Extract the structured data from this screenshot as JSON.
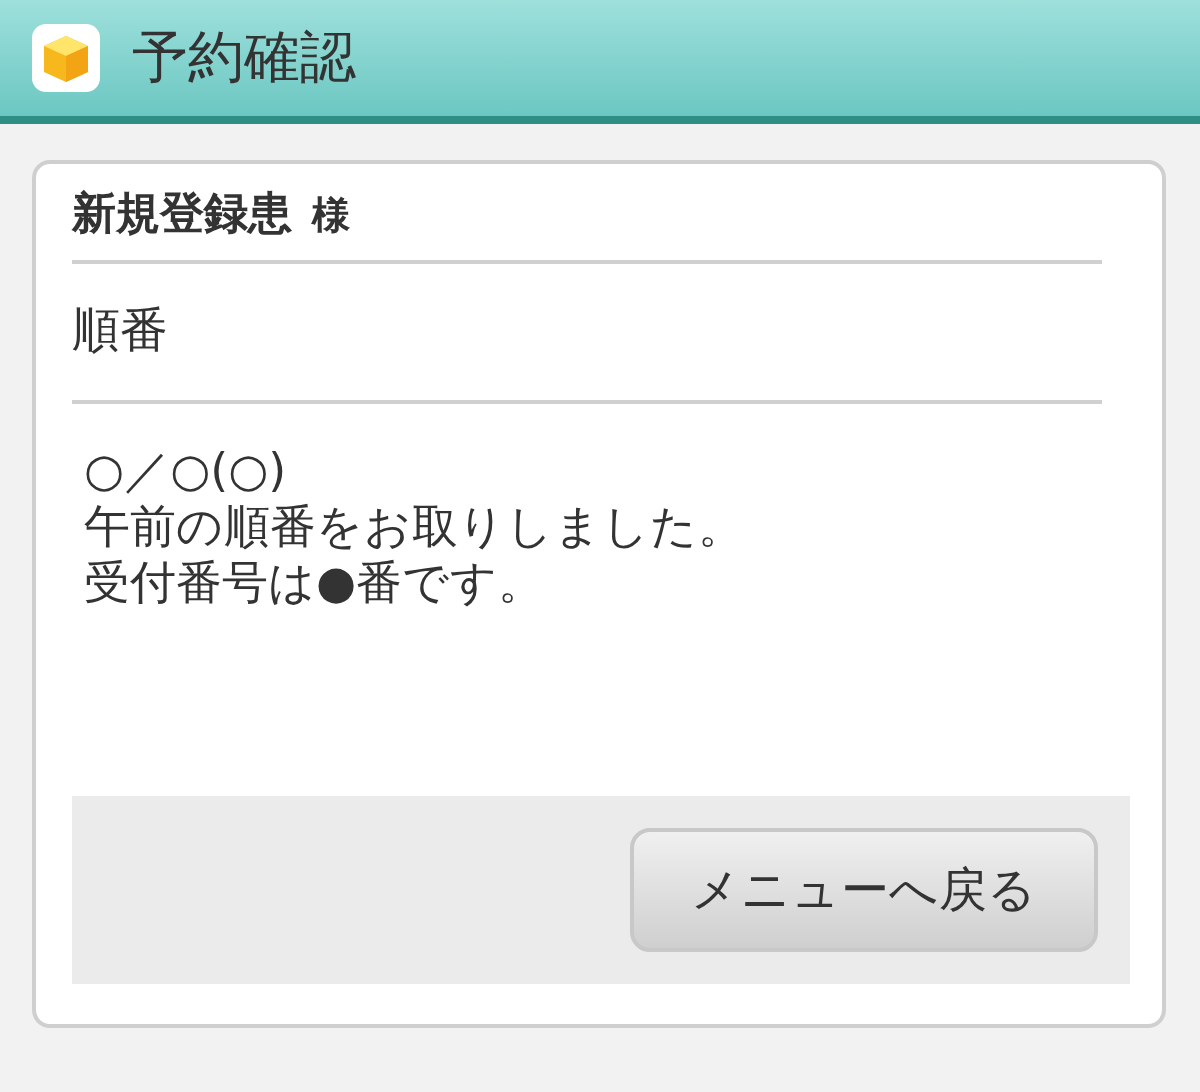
{
  "header": {
    "title": "予約確認"
  },
  "patient": {
    "name": "新規登録患",
    "honorific": "様"
  },
  "section_label": "順番",
  "message_lines": [
    "○／○(○)",
    "午前の順番をお取りしました。",
    "受付番号は●番です。"
  ],
  "buttons": [
    {
      "label": "メニューへ戻る"
    }
  ]
}
